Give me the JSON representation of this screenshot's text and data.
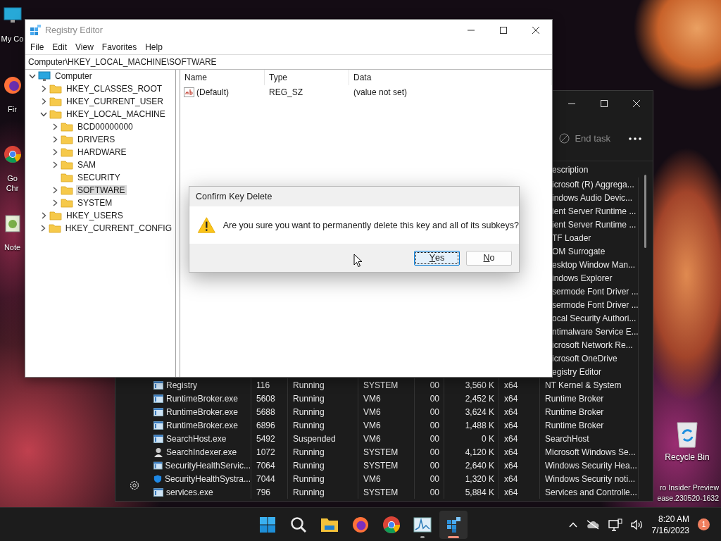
{
  "desktop_icons": [
    {
      "kind": "monitor",
      "label": "My Co"
    },
    {
      "kind": "firefox",
      "label": "Fir"
    },
    {
      "kind": "chrome",
      "label": "Go Chr"
    },
    {
      "kind": "notepad",
      "label": "Note"
    }
  ],
  "recycle_bin": {
    "label": "Recycle Bin"
  },
  "build_watermark": [
    "ro Insider Preview",
    "ease.230520-1632"
  ],
  "task_manager": {
    "end_task": {
      "label": "End task",
      "disabled": true
    },
    "description_header": "escription",
    "rows": [
      {
        "description": "icrosoft (R) Aggrega..."
      },
      {
        "description": "indows Audio Devic..."
      },
      {
        "description": "ient Server Runtime ..."
      },
      {
        "description": "ient Server Runtime ..."
      },
      {
        "description": "TF Loader"
      },
      {
        "description": "OM Surrogate"
      },
      {
        "description": "esktop Window Man..."
      },
      {
        "description": "indows Explorer"
      },
      {
        "description": "sermode Font Driver ..."
      },
      {
        "description": "sermode Font Driver ..."
      },
      {
        "description": "ocal Security Authori..."
      },
      {
        "description": "ntimalware Service E..."
      },
      {
        "description": "icrosoft Network Re..."
      },
      {
        "description": "icrosoft OneDrive"
      },
      {
        "description": "egistry Editor"
      },
      {
        "kind": "app",
        "name": "Registry",
        "pid": "116",
        "status": "Running",
        "user": "SYSTEM",
        "cpu": "00",
        "memory": "3,560 K",
        "arch": "x64",
        "description": "NT Kernel & System"
      },
      {
        "kind": "app",
        "name": "RuntimeBroker.exe",
        "pid": "5608",
        "status": "Running",
        "user": "VM6",
        "cpu": "00",
        "memory": "2,452 K",
        "arch": "x64",
        "description": "Runtime Broker"
      },
      {
        "kind": "app",
        "name": "RuntimeBroker.exe",
        "pid": "5688",
        "status": "Running",
        "user": "VM6",
        "cpu": "00",
        "memory": "3,624 K",
        "arch": "x64",
        "description": "Runtime Broker"
      },
      {
        "kind": "app",
        "name": "RuntimeBroker.exe",
        "pid": "6896",
        "status": "Running",
        "user": "VM6",
        "cpu": "00",
        "memory": "1,488 K",
        "arch": "x64",
        "description": "Runtime Broker"
      },
      {
        "kind": "app",
        "name": "SearchHost.exe",
        "pid": "5492",
        "status": "Suspended",
        "user": "VM6",
        "cpu": "00",
        "memory": "0 K",
        "arch": "x64",
        "description": "SearchHost"
      },
      {
        "kind": "user",
        "name": "SearchIndexer.exe",
        "pid": "1072",
        "status": "Running",
        "user": "SYSTEM",
        "cpu": "00",
        "memory": "4,120 K",
        "arch": "x64",
        "description": "Microsoft Windows Se..."
      },
      {
        "kind": "app",
        "name": "SecurityHealthServic...",
        "pid": "7064",
        "status": "Running",
        "user": "SYSTEM",
        "cpu": "00",
        "memory": "2,640 K",
        "arch": "x64",
        "description": "Windows Security Hea..."
      },
      {
        "kind": "shield",
        "name": "SecurityHealthSystra...",
        "pid": "7044",
        "status": "Running",
        "user": "VM6",
        "cpu": "00",
        "memory": "1,320 K",
        "arch": "x64",
        "description": "Windows Security noti..."
      },
      {
        "kind": "app",
        "name": "services.exe",
        "pid": "796",
        "status": "Running",
        "user": "SYSTEM",
        "cpu": "00",
        "memory": "5,884 K",
        "arch": "x64",
        "description": "Services and Controlle..."
      }
    ]
  },
  "registry_editor": {
    "title": "Registry Editor",
    "menu": [
      "File",
      "Edit",
      "View",
      "Favorites",
      "Help"
    ],
    "address": "Computer\\HKEY_LOCAL_MACHINE\\SOFTWARE",
    "tree": [
      {
        "kind": "computer",
        "label": "Computer",
        "expandable": true,
        "expanded": true,
        "selected": false,
        "children": [
          {
            "kind": "folder",
            "label": "HKEY_CLASSES_ROOT",
            "expandable": true,
            "expanded": false,
            "selected": false
          },
          {
            "kind": "folder",
            "label": "HKEY_CURRENT_USER",
            "expandable": true,
            "expanded": false,
            "selected": false
          },
          {
            "kind": "folder",
            "label": "HKEY_LOCAL_MACHINE",
            "expandable": true,
            "expanded": true,
            "selected": false,
            "children": [
              {
                "kind": "folder",
                "label": "BCD00000000",
                "expandable": true,
                "expanded": false,
                "selected": false
              },
              {
                "kind": "folder",
                "label": "DRIVERS",
                "expandable": true,
                "expanded": false,
                "selected": false
              },
              {
                "kind": "folder",
                "label": "HARDWARE",
                "expandable": true,
                "expanded": false,
                "selected": false
              },
              {
                "kind": "folder",
                "label": "SAM",
                "expandable": true,
                "expanded": false,
                "selected": false
              },
              {
                "kind": "folder",
                "label": "SECURITY",
                "expandable": false,
                "selected": false
              },
              {
                "kind": "folder",
                "label": "SOFTWARE",
                "expandable": true,
                "expanded": false,
                "selected": true
              },
              {
                "kind": "folder",
                "label": "SYSTEM",
                "expandable": true,
                "expanded": false,
                "selected": false
              }
            ]
          },
          {
            "kind": "folder",
            "label": "HKEY_USERS",
            "expandable": true,
            "expanded": false,
            "selected": false
          },
          {
            "kind": "folder",
            "label": "HKEY_CURRENT_CONFIG",
            "expandable": true,
            "expanded": false,
            "selected": false
          }
        ]
      }
    ],
    "columns": [
      "Name",
      "Type",
      "Data"
    ],
    "values": [
      {
        "name": "(Default)",
        "type": "REG_SZ",
        "data": "(value not set)"
      }
    ]
  },
  "dialog": {
    "title": "Confirm Key Delete",
    "message": "Are you sure you want to permanently delete this key and all of its subkeys?",
    "buttons": [
      {
        "label": "Yes",
        "focused": true
      },
      {
        "label": "No",
        "focused": false
      }
    ]
  },
  "taskbar": {
    "apps": [
      {
        "kind": "start",
        "running": false,
        "selected": false
      },
      {
        "kind": "search",
        "running": false,
        "selected": false
      },
      {
        "kind": "explorer",
        "running": false,
        "selected": false
      },
      {
        "kind": "firefox",
        "running": false,
        "selected": false
      },
      {
        "kind": "chrome",
        "running": false,
        "selected": false
      },
      {
        "kind": "perfmon",
        "running": true,
        "selected": false
      },
      {
        "kind": "regedit",
        "running": true,
        "selected": true
      }
    ],
    "clock": {
      "time": "8:20 AM",
      "date": "7/16/2023"
    },
    "notification_count": "1"
  }
}
